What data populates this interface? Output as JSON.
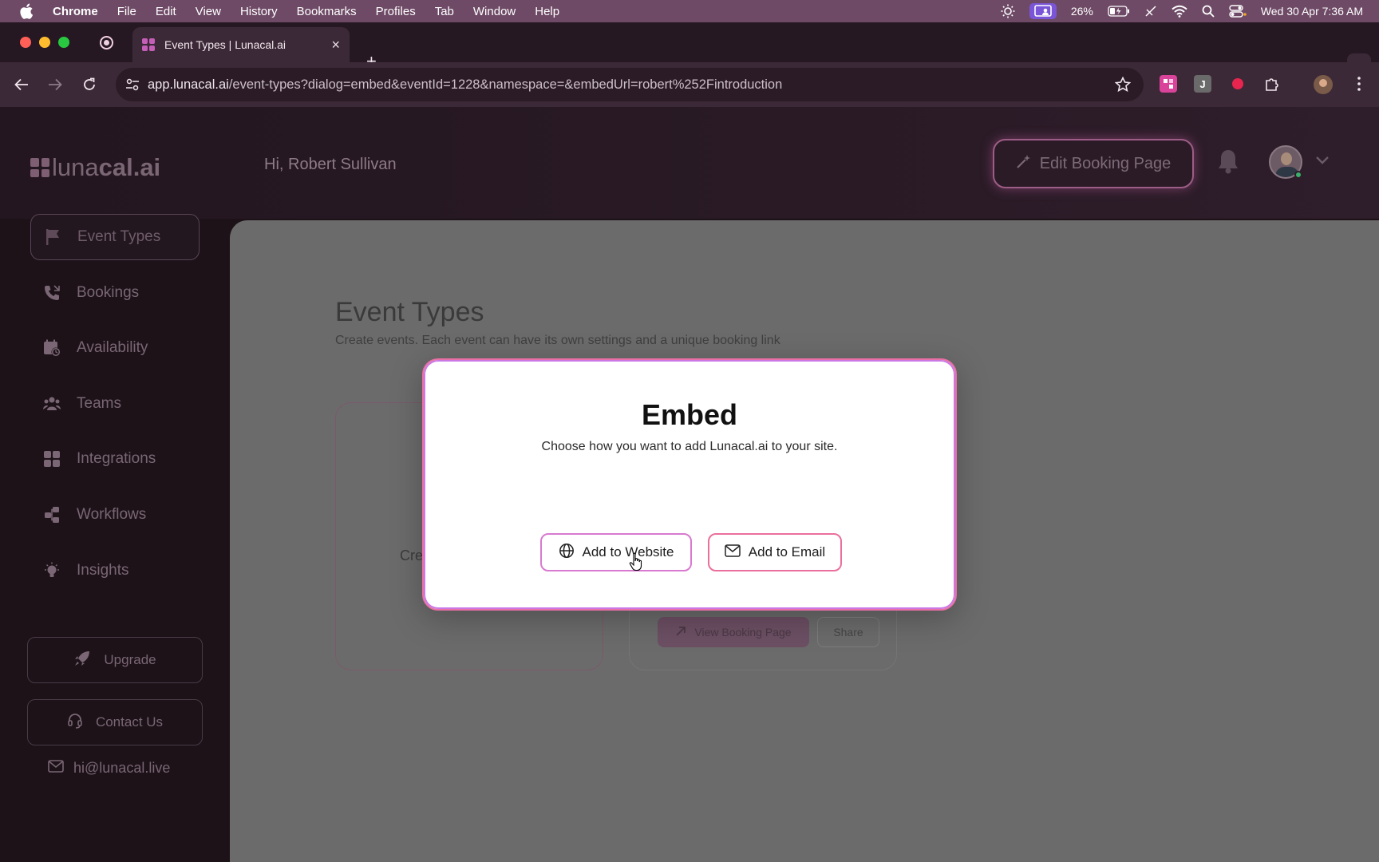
{
  "menubar": {
    "app_name": "Chrome",
    "items": [
      "File",
      "Edit",
      "View",
      "History",
      "Bookmarks",
      "Profiles",
      "Tab",
      "Window",
      "Help"
    ],
    "battery": "26%",
    "datetime": "Wed 30 Apr  7:36 AM"
  },
  "browser": {
    "tab_title": "Event Types | Lunacal.ai",
    "url_host": "app.lunacal.ai",
    "url_path": "/event-types?dialog=embed&eventId=1228&namespace=&embedUrl=robert%252Fintroduction",
    "extension_j_label": "J"
  },
  "header": {
    "logo_light": "luna",
    "logo_bold": "cal.ai",
    "greeting": "Hi, Robert Sullivan",
    "edit_booking_label": "Edit Booking Page"
  },
  "sidebar": {
    "items": [
      {
        "label": "Event Types",
        "icon": "flag-icon"
      },
      {
        "label": "Bookings",
        "icon": "phone-icon"
      },
      {
        "label": "Availability",
        "icon": "calendar-clock-icon"
      },
      {
        "label": "Teams",
        "icon": "users-icon"
      },
      {
        "label": "Integrations",
        "icon": "grid-icon"
      },
      {
        "label": "Workflows",
        "icon": "workflow-icon"
      },
      {
        "label": "Insights",
        "icon": "lightbulb-icon"
      }
    ],
    "upgrade_label": "Upgrade",
    "contact_label": "Contact Us",
    "email": "hi@lunacal.live"
  },
  "main": {
    "title": "Event Types",
    "subtitle": "Create events. Each event can have its own settings and a unique booking link",
    "create_card_partial": "Cre",
    "view_booking_label": "View Booking Page",
    "share_label": "Share"
  },
  "modal": {
    "title": "Embed",
    "subtitle": "Choose how you want to add Lunacal.ai to your site.",
    "add_website_label": "Add to Website",
    "add_email_label": "Add to Email"
  },
  "colors": {
    "modal_border": "#ea6fa4",
    "button_border_website": "#d87ad0",
    "button_border_email": "#ea6f9c",
    "overlay_gray": "#6b6b6b"
  }
}
